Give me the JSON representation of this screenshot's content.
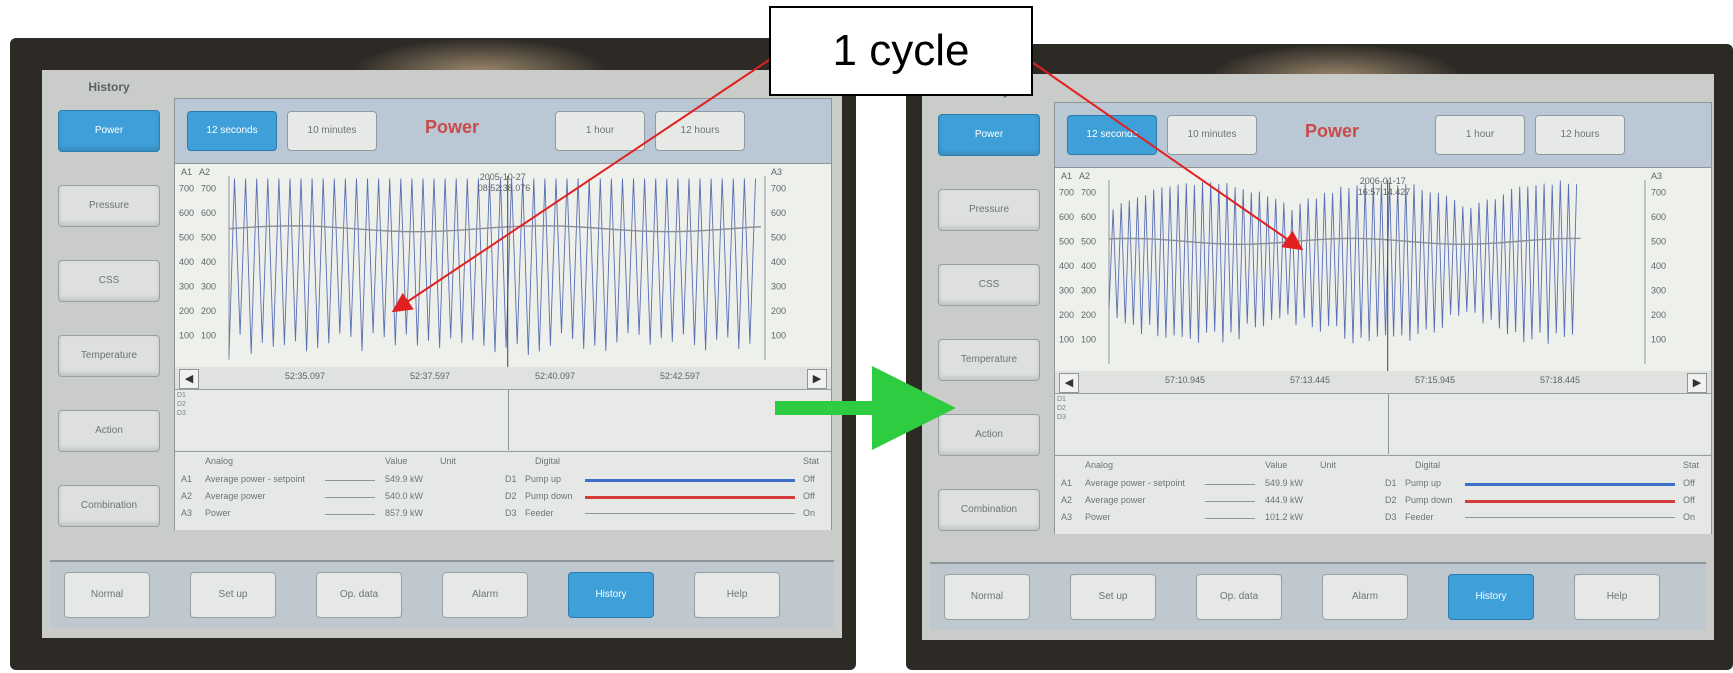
{
  "callout": {
    "label": "1 cycle"
  },
  "colors": {
    "arrow_red": "#e32020",
    "arrow_green": "#2ecc40",
    "active_btn": "#3f9fd8",
    "title_red": "#c94a4a"
  },
  "screens": [
    {
      "history_label": "History",
      "nav": [
        "Power",
        "Pressure",
        "CSS",
        "Temperature",
        "Action",
        "Combination"
      ],
      "nav_active": 0,
      "time_buttons": [
        "12 seconds",
        "10 minutes",
        "1 hour",
        "12 hours"
      ],
      "time_active": 0,
      "title": "Power",
      "axis_tags": {
        "a1": "A1",
        "a2": "A2",
        "a3": "A3"
      },
      "timestamp": "2005-10-27\n08:52:38.076",
      "y_ticks_left": [
        "700",
        "600",
        "500",
        "400",
        "300",
        "200",
        "100"
      ],
      "y_ticks_left2": [
        "700",
        "600",
        "500",
        "400",
        "300",
        "200",
        "100"
      ],
      "y_ticks_right": [
        "700",
        "600",
        "500",
        "400",
        "300",
        "200",
        "100"
      ],
      "x_ticks": [
        "52:35.097",
        "52:37.597",
        "52:40.097",
        "52:42.597"
      ],
      "digital_labels": [
        "D1",
        "D2",
        "D3"
      ],
      "table": {
        "headers": {
          "analog": "Analog",
          "value": "Value",
          "unit": "Unit",
          "digital": "Digital",
          "stat": "Stat"
        },
        "rows": [
          {
            "ch": "A1",
            "name": "Average power - setpoint",
            "value": "549.9 kW",
            "dch": "D1",
            "dname": "Pump up",
            "stat": "Off"
          },
          {
            "ch": "A2",
            "name": "Average power",
            "value": "540.0 kW",
            "dch": "D2",
            "dname": "Pump down",
            "stat": "Off"
          },
          {
            "ch": "A3",
            "name": "Power",
            "value": "857.9 kW",
            "dch": "D3",
            "dname": "Feeder",
            "stat": "On"
          }
        ]
      },
      "bottom": [
        "Normal",
        "Set up",
        "Op. data",
        "Alarm",
        "History",
        "Help"
      ],
      "bottom_active": 4,
      "chart_data": {
        "type": "line",
        "pattern": "regular",
        "ylim": [
          0,
          750
        ],
        "avg_level": 535,
        "cycles": 48
      }
    },
    {
      "history_label": "History",
      "nav": [
        "Power",
        "Pressure",
        "CSS",
        "Temperature",
        "Action",
        "Combination"
      ],
      "nav_active": 0,
      "time_buttons": [
        "12 seconds",
        "10 minutes",
        "1 hour",
        "12 hours"
      ],
      "time_active": 0,
      "title": "Power",
      "axis_tags": {
        "a1": "A1",
        "a2": "A2",
        "a3": "A3"
      },
      "timestamp": "2006-01-17\n16:57:14.427",
      "y_ticks_left": [
        "700",
        "600",
        "500",
        "400",
        "300",
        "200",
        "100"
      ],
      "y_ticks_left2": [
        "700",
        "600",
        "500",
        "400",
        "300",
        "200",
        "100"
      ],
      "y_ticks_right": [
        "700",
        "600",
        "500",
        "400",
        "300",
        "200",
        "100"
      ],
      "x_ticks": [
        "57:10.945",
        "57:13.445",
        "57:15.945",
        "57:18.445"
      ],
      "digital_labels": [
        "D1",
        "D2",
        "D3"
      ],
      "table": {
        "headers": {
          "analog": "Analog",
          "value": "Value",
          "unit": "Unit",
          "digital": "Digital",
          "stat": "Stat"
        },
        "rows": [
          {
            "ch": "A1",
            "name": "Average power - setpoint",
            "value": "549.9 kW",
            "dch": "D1",
            "dname": "Pump up",
            "stat": "Off"
          },
          {
            "ch": "A2",
            "name": "Average power",
            "value": "444.9 kW",
            "dch": "D2",
            "dname": "Pump down",
            "stat": "Off"
          },
          {
            "ch": "A3",
            "name": "Power",
            "value": "101.2 kW",
            "dch": "D3",
            "dname": "Feeder",
            "stat": "On"
          }
        ]
      },
      "bottom": [
        "Normal",
        "Set up",
        "Op. data",
        "Alarm",
        "History",
        "Help"
      ],
      "bottom_active": 4,
      "chart_data": {
        "type": "line",
        "pattern": "irregular",
        "ylim": [
          0,
          750
        ],
        "avg_level": 500,
        "cycles": 58
      }
    }
  ]
}
